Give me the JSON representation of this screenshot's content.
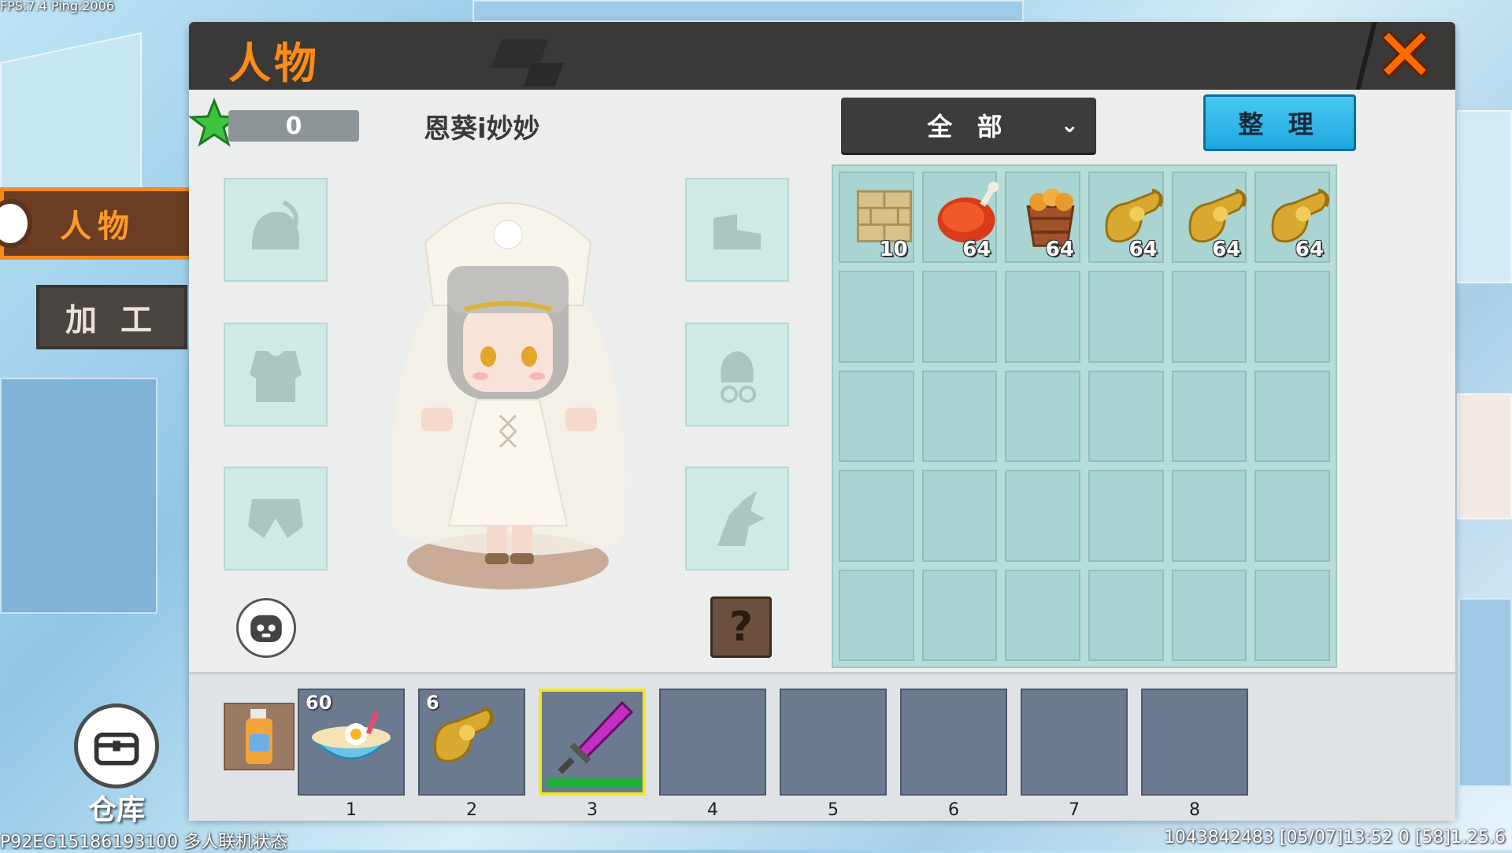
{
  "hud": {
    "fps_ping": "FPS:7.4 Ping:2006",
    "session_info": "P92EG15186193100 多人联机状态",
    "bottom_right_info": "1043842483   [05/07]13:52 0   [58]1.25.6"
  },
  "side_tabs": {
    "character_label": "人物",
    "crafting_label": "加 工"
  },
  "window": {
    "title": "人物",
    "close_symbol": "✕"
  },
  "player": {
    "level_value": "0",
    "name": "恩葵i妙妙"
  },
  "filter": {
    "selected": "全 部",
    "chevron": "⌄"
  },
  "sort_label": "整 理",
  "help_symbol": "?",
  "inventory": [
    {
      "item": "wood-planks-icon",
      "count": "10"
    },
    {
      "item": "roast-meat-icon",
      "count": "64"
    },
    {
      "item": "fried-chicken-bucket-icon",
      "count": "64"
    },
    {
      "item": "golden-scroll-icon",
      "count": "64"
    },
    {
      "item": "golden-scroll-icon",
      "count": "64"
    },
    {
      "item": "golden-scroll-icon",
      "count": "64"
    }
  ],
  "hotbar": [
    {
      "num": "1",
      "item": "noodle-bowl-icon",
      "count": "60"
    },
    {
      "num": "2",
      "item": "golden-scroll-icon",
      "count": "6"
    },
    {
      "num": "3",
      "item": "purple-sword-icon",
      "count": "",
      "durability": 1.0
    },
    {
      "num": "4"
    },
    {
      "num": "5"
    },
    {
      "num": "6"
    },
    {
      "num": "7"
    },
    {
      "num": "8"
    }
  ],
  "warehouse_label": "仓库",
  "colors": {
    "accent_orange": "#ff8a14",
    "sort_blue": "#1ea8e0",
    "selected_slot": "#f7e61a"
  }
}
